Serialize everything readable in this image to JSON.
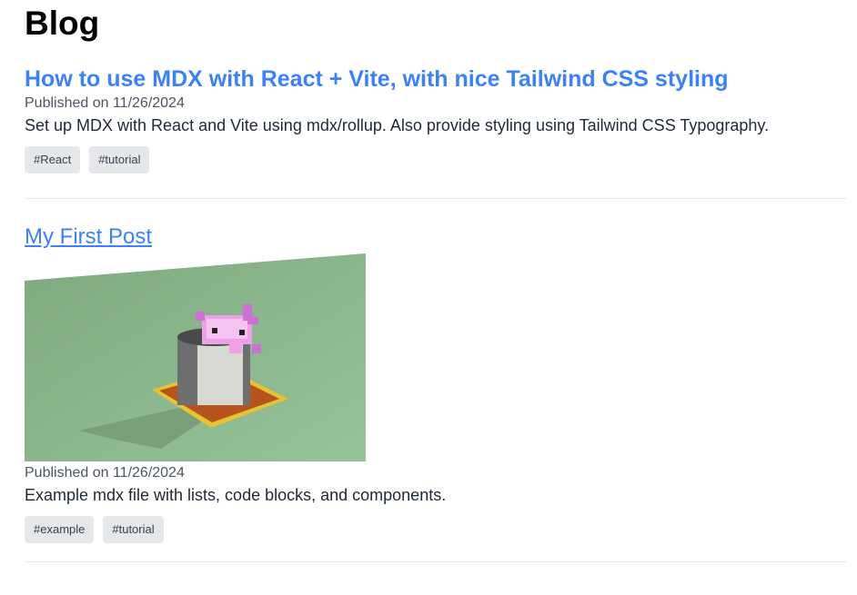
{
  "page": {
    "title": "Blog"
  },
  "posts": [
    {
      "title": "How to use MDX with React + Vite, with nice Tailwind CSS styling",
      "date": "Published on 11/26/2024",
      "description": "Set up MDX with React and Vite using mdx/rollup. Also provide styling using Tailwind CSS Typography.",
      "tags": [
        "#React",
        "#tutorial"
      ]
    },
    {
      "title": "My First Post",
      "date": "Published on 11/26/2024",
      "description": "Example mdx file with lists, code blocks, and components.",
      "tags": [
        "#example",
        "#tutorial"
      ],
      "image": "axolotl-in-bucket-voxel-render"
    }
  ],
  "colors": {
    "link": "#3b82f6",
    "tag_bg": "#e5e7eb",
    "divider": "#e5e7eb",
    "image_bg": "#8fb88f"
  }
}
